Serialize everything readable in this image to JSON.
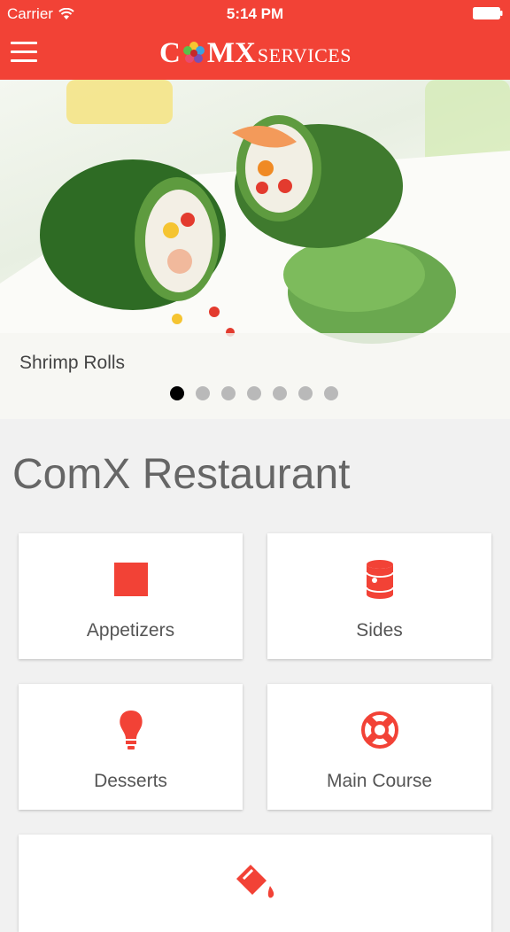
{
  "status_bar": {
    "carrier": "Carrier",
    "time": "5:14 PM"
  },
  "header": {
    "logo": {
      "c": "C",
      "mx": "MX",
      "services": "SERVICES"
    }
  },
  "carousel": {
    "caption": "Shrimp Rolls",
    "slide_count": 7,
    "active_index": 0
  },
  "page_title": "ComX Restaurant",
  "categories": [
    {
      "label": "Appetizers",
      "icon": "square-icon"
    },
    {
      "label": "Sides",
      "icon": "can-icon"
    },
    {
      "label": "Desserts",
      "icon": "bulb-icon"
    },
    {
      "label": "Main Course",
      "icon": "life-ring-icon"
    },
    {
      "label": "",
      "icon": "paint-bucket-icon"
    }
  ],
  "colors": {
    "accent": "#f24236",
    "text": "#666666"
  }
}
